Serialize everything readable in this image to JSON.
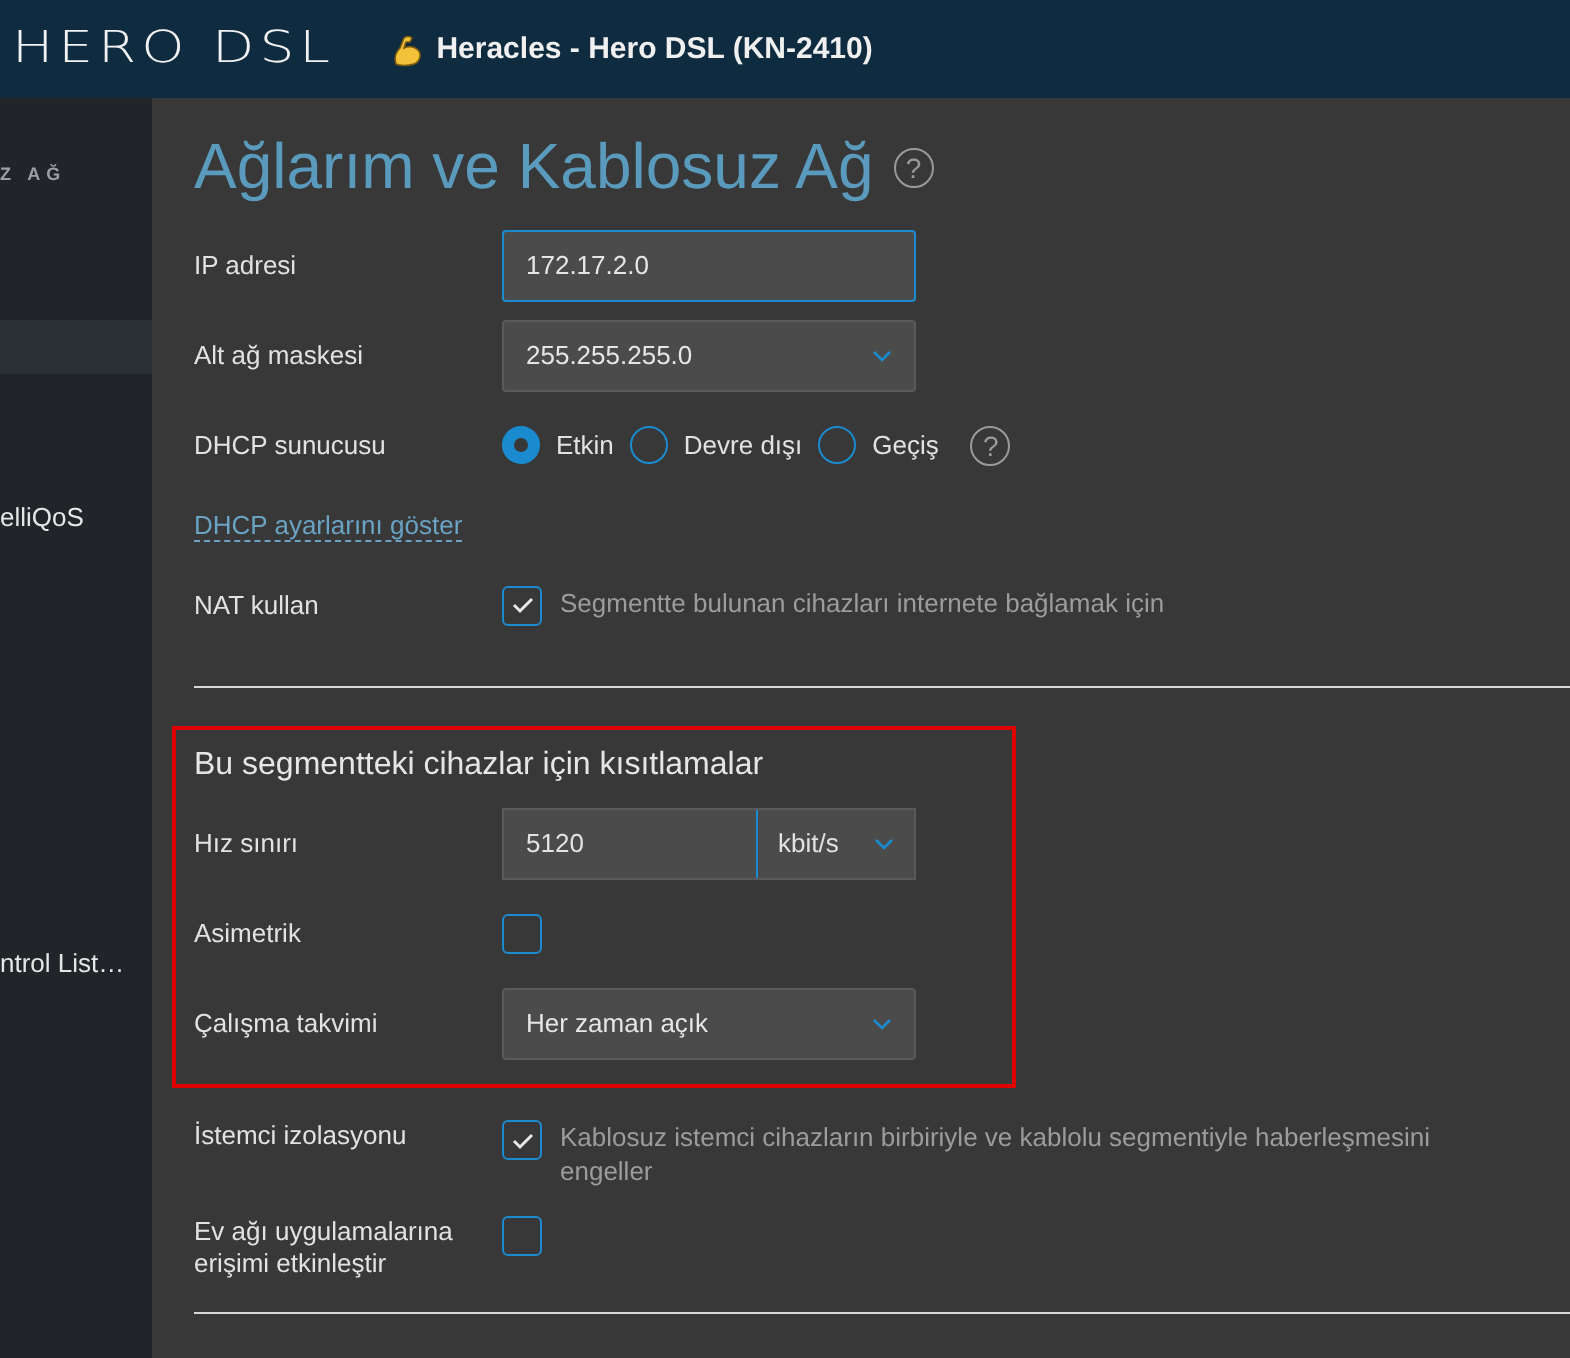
{
  "header": {
    "brand": "HERO DSL",
    "device": "Heracles - Hero DSL (KN-2410)"
  },
  "sidebar": {
    "items": [
      {
        "kind": "section",
        "label": "Z AĞ",
        "selected": false
      },
      {
        "kind": "item",
        "selected": true
      },
      {
        "kind": "item",
        "label": "elliQoS",
        "selected": false
      },
      {
        "kind": "item",
        "label": "ntrol List…",
        "selected": false
      }
    ]
  },
  "page": {
    "title": "Ağlarım ve Kablosuz Ağ",
    "help": "?"
  },
  "fields": [
    {
      "kind": "text",
      "label": "IP adresi",
      "value": "172.17.2.0",
      "focused": true
    },
    {
      "kind": "select",
      "label": "Alt ağ maskesi",
      "value": "255.255.255.0"
    },
    {
      "kind": "radio",
      "label": "DHCP sunucusu",
      "options": [
        {
          "label": "Etkin",
          "selected": true
        },
        {
          "label": "Devre dışı",
          "selected": false
        },
        {
          "label": "Geçiş",
          "selected": false
        }
      ],
      "help": "?"
    },
    {
      "kind": "link",
      "label": "DHCP ayarlarını göster"
    },
    {
      "kind": "checkbox",
      "label": "NAT kullan",
      "checked": true,
      "hint": "Segmentte bulunan cihazları internete bağlamak için"
    }
  ],
  "restrictions": {
    "title": "Bu segmentteki cihazlar için kısıtlamalar",
    "fields": [
      {
        "kind": "unit",
        "label": "Hız sınırı",
        "value": "5120",
        "unit": "kbit/s"
      },
      {
        "kind": "checkbox",
        "label": "Asimetrik",
        "checked": false
      },
      {
        "kind": "select",
        "label": "Çalışma takvimi",
        "value": "Her zaman açık"
      }
    ]
  },
  "more_fields": [
    {
      "kind": "checkbox",
      "label": "İstemci izolasyonu",
      "checked": true,
      "hint": "Kablosuz istemci cihazların birbiriyle ve kablolu segmentiyle haberleşmesini engeller"
    },
    {
      "kind": "checkbox",
      "label": "Ev ağı uygulamalarına erişimi etkinleştir",
      "checked": false
    }
  ]
}
